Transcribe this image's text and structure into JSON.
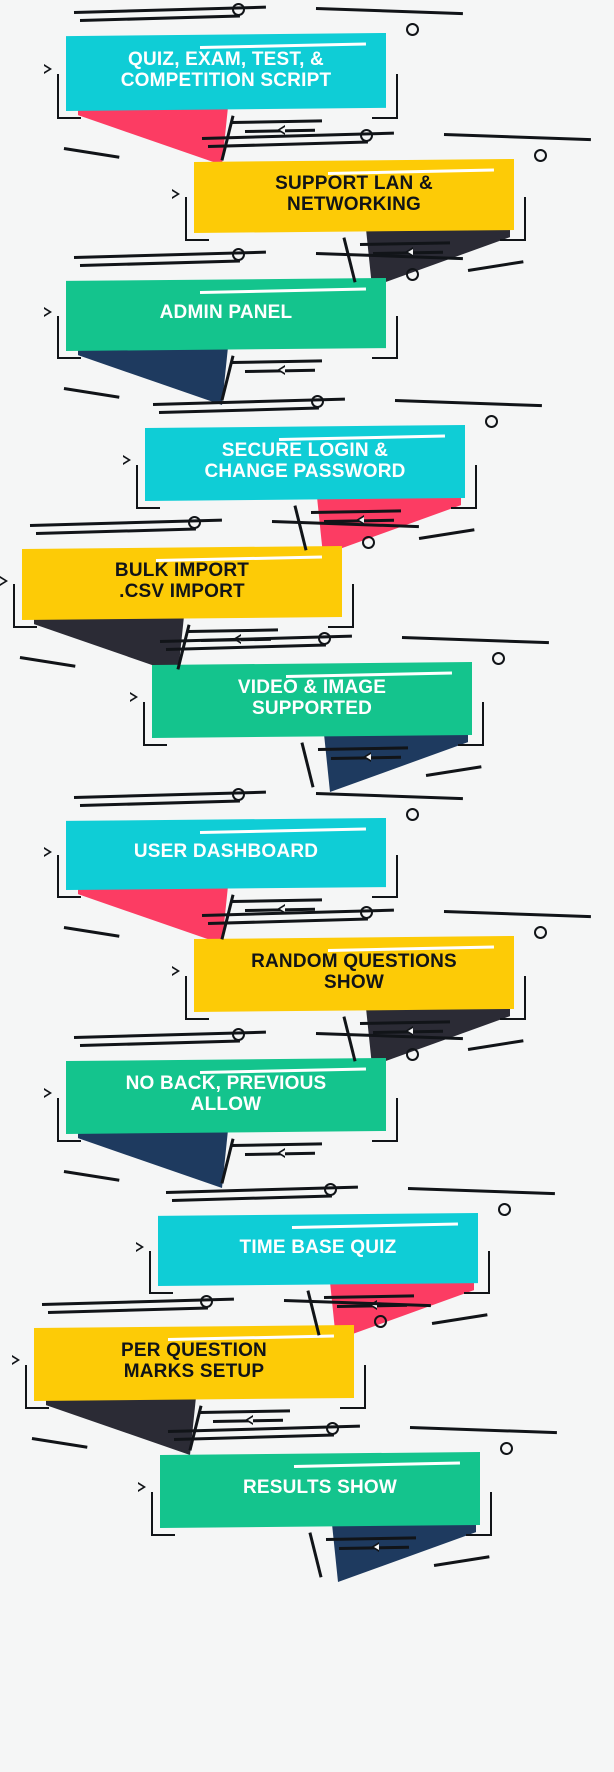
{
  "page": {
    "title": "Quiz Script Feature Banners",
    "background_color": "#f5f6f6"
  },
  "colors": {
    "cyan": "#0FCDD6",
    "yellow": "#FDCB06",
    "green": "#14C48D",
    "pink": "#FC3C63",
    "navy": "#1E3A5F",
    "charcoal": "#2B2B35",
    "ink": "#111418",
    "white": "#FFFFFF"
  },
  "groups": [
    {
      "id": "group-1",
      "banners": [
        {
          "id": "banner-quiz-exam-test-competition-script",
          "text": "QUIZ, EXAM, TEST, &\nCOMPETITION SCRIPT",
          "color_key": "cyan",
          "text_color": "#FFFFFF",
          "fold_color": "#FC3C63",
          "fold_side": "left"
        },
        {
          "id": "banner-support-lan-networking",
          "text": "SUPPORT LAN &\nNETWORKING",
          "color_key": "yellow",
          "text_color": "#111418",
          "fold_color": "#2B2B35",
          "fold_side": "right"
        },
        {
          "id": "banner-admin-panel",
          "text": "ADMIN PANEL",
          "color_key": "green",
          "text_color": "#FFFFFF",
          "fold_color": "#1E3A5F",
          "fold_side": "left"
        }
      ]
    },
    {
      "id": "group-2",
      "banners": [
        {
          "id": "banner-secure-login-change-password",
          "text": "SECURE LOGIN &\nCHANGE PASSWORD",
          "color_key": "cyan",
          "text_color": "#FFFFFF",
          "fold_color": "#FC3C63",
          "fold_side": "right"
        },
        {
          "id": "banner-bulk-import-csv-import",
          "text": "BULK IMPORT\n.CSV IMPORT",
          "color_key": "yellow",
          "text_color": "#111418",
          "fold_color": "#2B2B35",
          "fold_side": "left"
        },
        {
          "id": "banner-video-image-supported",
          "text": "VIDEO & IMAGE\nSUPPORTED",
          "color_key": "green",
          "text_color": "#FFFFFF",
          "fold_color": "#1E3A5F",
          "fold_side": "right"
        }
      ]
    },
    {
      "id": "group-3",
      "banners": [
        {
          "id": "banner-user-dashboard",
          "text": "USER DASHBOARD",
          "color_key": "cyan",
          "text_color": "#FFFFFF",
          "fold_color": "#FC3C63",
          "fold_side": "left"
        },
        {
          "id": "banner-random-questions-show",
          "text": "RANDOM QUESTIONS\nSHOW",
          "color_key": "yellow",
          "text_color": "#111418",
          "fold_color": "#2B2B35",
          "fold_side": "right"
        },
        {
          "id": "banner-no-back-previous-allow",
          "text": "NO BACK, PREVIOUS\nALLOW",
          "color_key": "green",
          "text_color": "#FFFFFF",
          "fold_color": "#1E3A5F",
          "fold_side": "left"
        }
      ]
    },
    {
      "id": "group-4",
      "banners": [
        {
          "id": "banner-time-base-quiz",
          "text": "TIME BASE QUIZ",
          "color_key": "cyan",
          "text_color": "#FFFFFF",
          "fold_color": "#FC3C63",
          "fold_side": "right"
        },
        {
          "id": "banner-per-question-marks-setup",
          "text": "PER QUESTION\nMARKS SETUP",
          "color_key": "yellow",
          "text_color": "#111418",
          "fold_color": "#2B2B35",
          "fold_side": "left"
        },
        {
          "id": "banner-results-show",
          "text": "RESULTS SHOW",
          "color_key": "green",
          "text_color": "#FFFFFF",
          "fold_color": "#1E3A5F",
          "fold_side": "right"
        }
      ]
    }
  ]
}
